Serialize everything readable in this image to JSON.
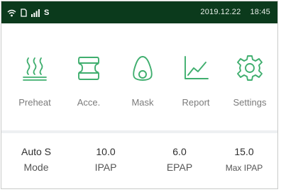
{
  "status_bar": {
    "carrier": "S",
    "date": "2019.12.22",
    "time": "18:45",
    "icons": [
      "wifi-icon",
      "sim-card-icon",
      "signal-icon"
    ]
  },
  "menu": {
    "items": [
      {
        "label": "Preheat",
        "icon": "heat-waves-icon"
      },
      {
        "label": "Acce.",
        "icon": "humidifier-chamber-icon"
      },
      {
        "label": "Mask",
        "icon": "mask-icon"
      },
      {
        "label": "Report",
        "icon": "line-chart-icon"
      },
      {
        "label": "Settings",
        "icon": "gear-icon"
      }
    ]
  },
  "params": [
    {
      "value": "Auto S",
      "label": "Mode"
    },
    {
      "value": "10.0",
      "label": "IPAP"
    },
    {
      "value": "6.0",
      "label": "EPAP"
    },
    {
      "value": "15.0",
      "label": "Max IPAP"
    }
  ],
  "colors": {
    "status_bar": "#0b3a1c",
    "accent": "#3fae6e",
    "label": "#7b7b7b"
  }
}
